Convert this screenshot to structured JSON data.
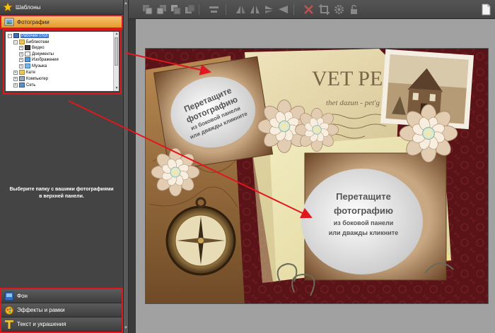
{
  "sidebar": {
    "templates_label": "Шаблоны",
    "photos_label": "Фотографии",
    "hint_line1": "Выберите папку с вашими фотографиями",
    "hint_line2": "в верхней панели.",
    "bottom": [
      {
        "label": "Фон",
        "icon": "background-icon"
      },
      {
        "label": "Эффекты и рамки",
        "icon": "effects-icon"
      },
      {
        "label": "Текст и украшения",
        "icon": "text-icon"
      }
    ]
  },
  "tree": {
    "root": "Рабочий стол",
    "libraries": "Библиотеки",
    "video": "Видео",
    "documents": "Документы",
    "images": "Изображения",
    "music": "Музыка",
    "user": "Катя",
    "computer": "Компьютер",
    "network": "Сеть"
  },
  "placeholder": {
    "line1": "Перетащите",
    "line2": "фотографию",
    "line3": "из боковой панели",
    "line4": "или дважды кликните"
  },
  "collage_text": {
    "big": "VET PE БАЦ",
    "script": "thet dazun - pet'g"
  },
  "colors": {
    "accent_red": "#e0181d",
    "photos_tab": "#f0ae4c",
    "panel": "#444444",
    "workspace": "#a1a1a1"
  }
}
